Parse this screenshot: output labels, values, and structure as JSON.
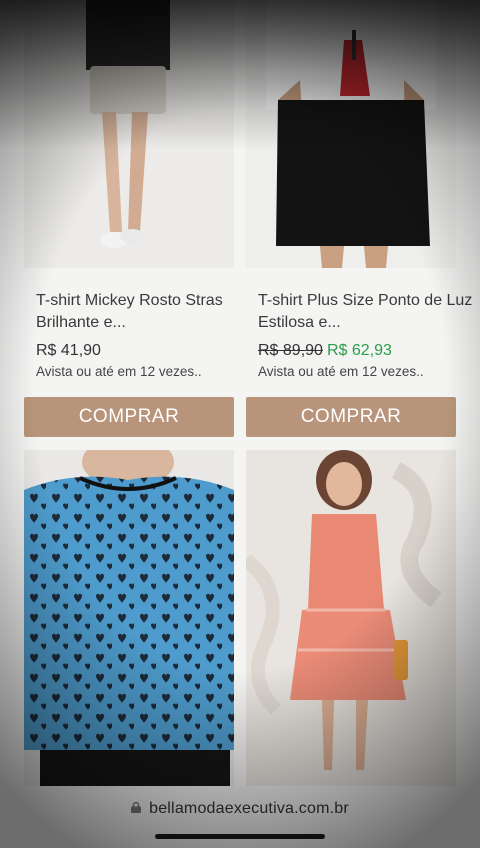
{
  "products": [
    {
      "title": "T-shirt Mickey Rosto Stras Brilhante e...",
      "price": "R$ 41,90",
      "installments": "Avista ou até em 12 vezes..",
      "buy_label": "COMPRAR"
    },
    {
      "title": "T-shirt Plus Size Ponto de Luz Estilosa e...",
      "old_price": "R$ 89,90",
      "new_price": "R$ 62,93",
      "installments": "Avista ou até em 12 vezes..",
      "buy_label": "COMPRAR"
    }
  ],
  "browser": {
    "url": "bellamodaexecutiva.com.br",
    "icon": "lock-icon"
  },
  "colors": {
    "buy_button": "#b8957a",
    "sale_price": "#2a9d47"
  }
}
